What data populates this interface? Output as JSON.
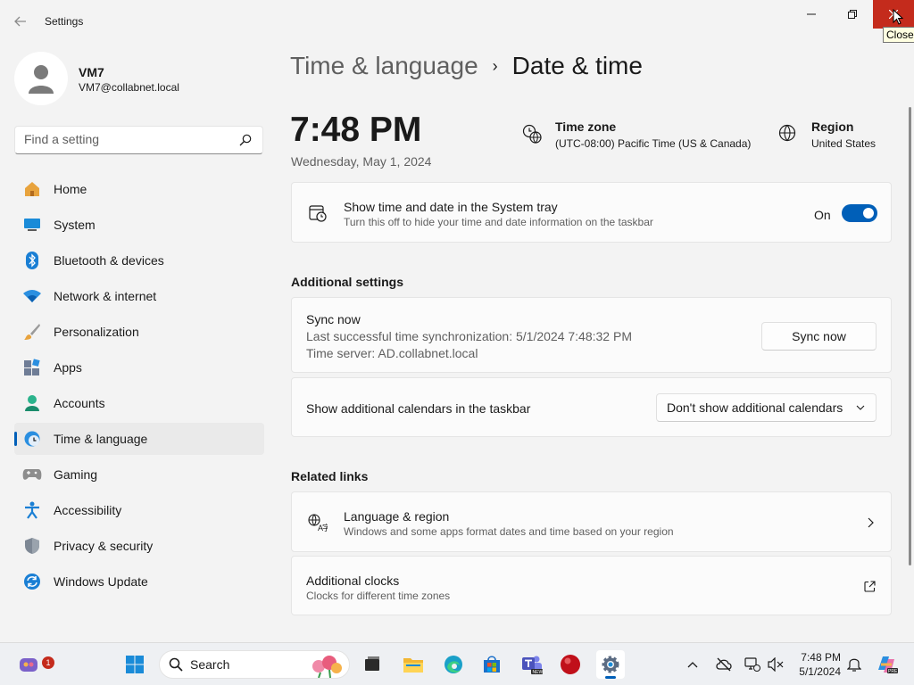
{
  "window": {
    "title": "Settings",
    "close_tooltip": "Close"
  },
  "profile": {
    "name": "VM7",
    "email": "VM7@collabnet.local"
  },
  "search": {
    "placeholder": "Find a setting"
  },
  "nav": [
    {
      "label": "Home",
      "icon": "home-icon"
    },
    {
      "label": "System",
      "icon": "system-icon"
    },
    {
      "label": "Bluetooth & devices",
      "icon": "bluetooth-icon"
    },
    {
      "label": "Network & internet",
      "icon": "network-icon"
    },
    {
      "label": "Personalization",
      "icon": "brush-icon"
    },
    {
      "label": "Apps",
      "icon": "apps-icon"
    },
    {
      "label": "Accounts",
      "icon": "accounts-icon"
    },
    {
      "label": "Time & language",
      "icon": "time-language-icon",
      "active": true
    },
    {
      "label": "Gaming",
      "icon": "gaming-icon"
    },
    {
      "label": "Accessibility",
      "icon": "accessibility-icon"
    },
    {
      "label": "Privacy & security",
      "icon": "shield-icon"
    },
    {
      "label": "Windows Update",
      "icon": "update-icon"
    }
  ],
  "breadcrumb": {
    "parent": "Time & language",
    "separator": "›",
    "current": "Date & time"
  },
  "clock": {
    "time": "7:48 PM",
    "date": "Wednesday, May 1, 2024"
  },
  "timezone": {
    "title": "Time zone",
    "value": "(UTC-08:00) Pacific Time (US & Canada)"
  },
  "region": {
    "title": "Region",
    "value": "United States"
  },
  "tray_setting": {
    "title": "Show time and date in the System tray",
    "subtitle": "Turn this off to hide your time and date information on the taskbar",
    "state_label": "On",
    "enabled": true
  },
  "additional": {
    "heading": "Additional settings",
    "sync": {
      "title": "Sync now",
      "last_sync": "Last successful time synchronization: 5/1/2024 7:48:32 PM",
      "server": "Time server: AD.collabnet.local",
      "button_label": "Sync now"
    },
    "calendars": {
      "title": "Show additional calendars in the taskbar",
      "selected": "Don't show additional calendars"
    }
  },
  "related": {
    "heading": "Related links",
    "language_region": {
      "title": "Language & region",
      "subtitle": "Windows and some apps format dates and time based on your region"
    },
    "clocks": {
      "title": "Additional clocks",
      "subtitle": "Clocks for different time zones"
    }
  },
  "taskbar": {
    "search_label": "Search",
    "chat_badge": "1",
    "time": "7:48 PM",
    "date": "5/1/2024"
  },
  "colors": {
    "accent": "#005fb8",
    "close_red": "#c42b1c"
  }
}
